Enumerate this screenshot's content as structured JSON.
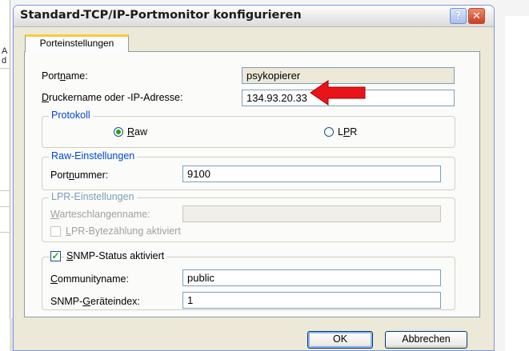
{
  "dialog": {
    "title": "Standard-TCP/IP-Portmonitor konfigurieren",
    "help_glyph": "?",
    "close_glyph": "✕"
  },
  "tab": {
    "label": "Porteinstellungen"
  },
  "port": {
    "name_label_pre": "Port",
    "name_label_u": "n",
    "name_label_post": "ame:",
    "name_value": "psykopierer",
    "printer_label_pre": "",
    "printer_label_u": "D",
    "printer_label_post": "ruckername oder -IP-Adresse:",
    "printer_value": "134.93.20.33"
  },
  "protocol": {
    "title": "Protokoll",
    "raw_label_u": "R",
    "raw_label_post": "aw",
    "lpr_label_pre": "L",
    "lpr_label_u": "P",
    "lpr_label_post": "R",
    "selected": "Raw"
  },
  "raw_settings": {
    "title": "Raw-Einstellungen",
    "port_label_pre": "Port",
    "port_label_u": "n",
    "port_label_post": "ummer:",
    "port_value": "9100"
  },
  "lpr_settings": {
    "title": "LPR-Einstellungen",
    "queue_label_u": "W",
    "queue_label_post": "arteschlangenname:",
    "queue_value": "",
    "bytecount_label_u": "L",
    "bytecount_label_post": "PR-Bytezählung aktiviert"
  },
  "snmp": {
    "enabled_label_u": "S",
    "enabled_label_post": "NMP-Status aktiviert",
    "enabled_checked": true,
    "community_label_u": "C",
    "community_label_post": "ommunityname:",
    "community_value": "public",
    "index_label_pre": "SNMP-",
    "index_label_u": "G",
    "index_label_post": "eräteindex:",
    "index_value": "1"
  },
  "buttons": {
    "ok": "OK",
    "cancel": "Abbrechen"
  },
  "background": {
    "glyphs": [
      "A",
      "d"
    ]
  },
  "colors": {
    "arrow": "#e8141a",
    "accent": "#0046d5",
    "tab_highlight": "#ffc83c"
  }
}
